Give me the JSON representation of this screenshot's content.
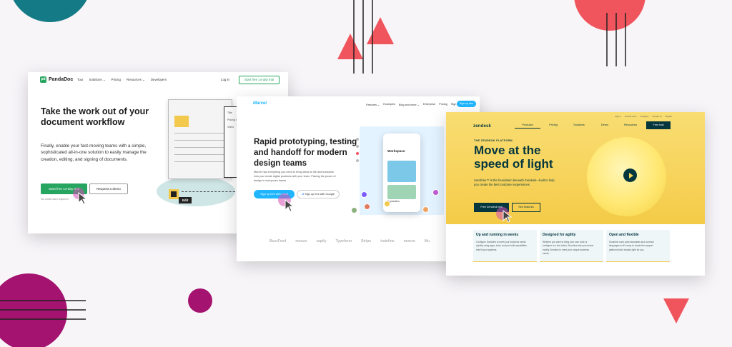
{
  "palette": {
    "coral": "#f0555d",
    "magenta": "#a4136f",
    "teal": "#147a85",
    "green": "#25a55f",
    "marvel_blue": "#1fb6ff",
    "zendesk_dark": "#03363d",
    "zendesk_yellow": "#f7d35b"
  },
  "pandadoc": {
    "logo": "PandaDoc",
    "logo_mark": "pd",
    "nav": [
      "Tour",
      "Solutions ⌄",
      "Pricing",
      "Resources ⌄",
      "Developers"
    ],
    "login": "Log in",
    "trial_top": "Start free 14-day trial",
    "headline": "Take the work out of your document workflow",
    "subtext": "Finally, enable your fast-moving teams with a simple, sophisticated all-in-one solution to easily manage the creation, editing, and signing of documents.",
    "cta_primary": "Start free 14-day trial",
    "cta_secondary": "Request a demo",
    "note": "No credit card required",
    "side_doc_labels": [
      "Title",
      "Pricing table",
      "Video"
    ],
    "edit_label": "Edit"
  },
  "marvel": {
    "logo": "Marvel",
    "nav": [
      "Features ⌄",
      "Examples",
      "Blog and more ⌄",
      "Enterprise",
      "Pricing",
      "Sign in"
    ],
    "signup_top": "Sign up free",
    "headline": "Rapid prototyping, testing and handoff for modern design teams",
    "subtext": "Marvel has everything you need to bring ideas to life and transform how you create digital products with your team. Placing the power of design in everyones hands.",
    "cta_primary": "Sign up free with email",
    "cta_google_mark": "G",
    "cta_google": "Sign up free with Google",
    "phone_title": "Workspace",
    "phone_caption": "Exploration",
    "customer_logos": [
      "BuzzFeed",
      "monzo",
      "zapify",
      "Typeform",
      "Stripe",
      "trainline",
      "monzo",
      "Mu"
    ]
  },
  "zendesk": {
    "utility": [
      "Sign in",
      "Product tours",
      "Company",
      "Contact us",
      "English"
    ],
    "logo": "zendesk",
    "tabs": [
      "Products",
      "Pricing",
      "Solutions",
      "Demo",
      "Resources"
    ],
    "free_trial_top": "Free trial",
    "eyebrow": "THE ZENDESK PLATFORM",
    "headline": "Move at the speed of light",
    "subtext": "Sunshine™ is the foundation beneath Zendesk—built to help you create the best customer experiences.",
    "cta_primary": "Free Zendesk trial",
    "cta_secondary": "See features",
    "cards": [
      {
        "title": "Up and running in weeks",
        "body": "Configure Sunshine to meet your business needs quickly using apps, tools, and pre-built capabilities that fit your systems."
      },
      {
        "title": "Designed for agility",
        "body": "Whether you want to bring your own code or configure in a few clicks, Sunshine lets your teams modify Zendesk to meet your unique business needs."
      },
      {
        "title": "Open and flexible",
        "body": "Sunshine uses open standards and common languages so it's easy to create the support platform that's exactly right for you."
      }
    ]
  }
}
